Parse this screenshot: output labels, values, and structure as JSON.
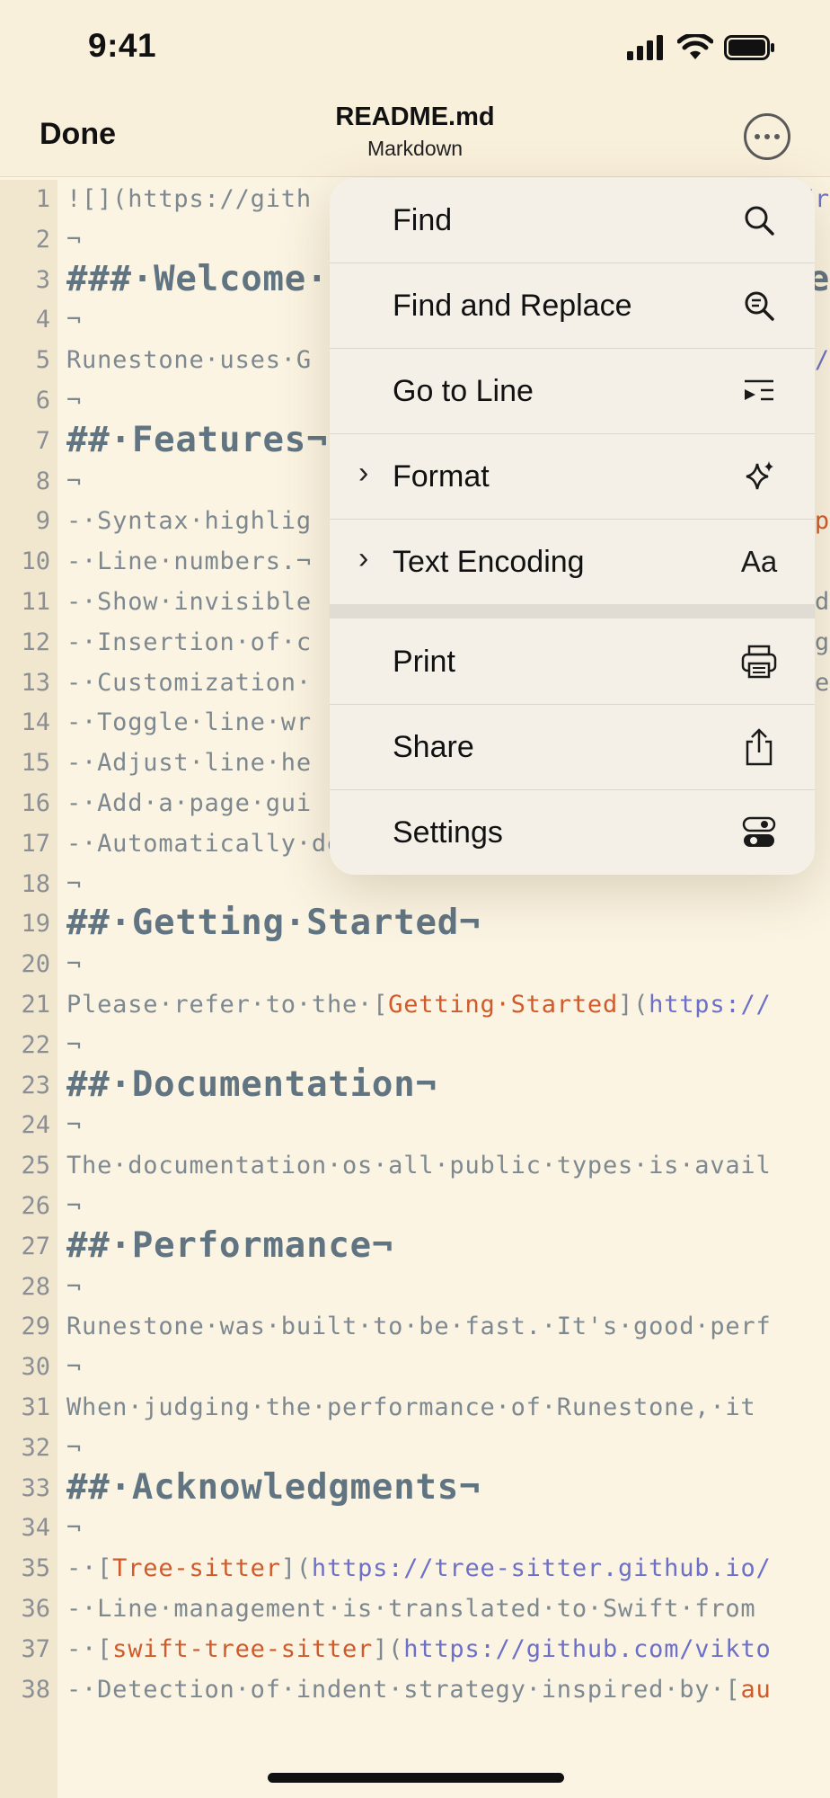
{
  "status": {
    "time": "9:41"
  },
  "nav": {
    "done": "Done",
    "title": "README.md",
    "subtitle": "Markdown"
  },
  "editor": {
    "lines": [
      {
        "n": "1",
        "t": "![](https://gith",
        "end": "/r"
      },
      {
        "n": "2",
        "t": "¬"
      },
      {
        "n": "3",
        "t": "###·Welcome·t",
        "end": "e",
        "h": true
      },
      {
        "n": "4",
        "t": "¬"
      },
      {
        "n": "5",
        "t": "Runestone·uses·G",
        "end": "//"
      },
      {
        "n": "6",
        "t": "¬"
      },
      {
        "n": "7",
        "t": "##·Features¬",
        "h": true
      },
      {
        "n": "8",
        "t": "¬"
      },
      {
        "n": "9",
        "t": "-·Syntax·highlig",
        "end": "ap"
      },
      {
        "n": "10",
        "t": "-·Line·numbers.¬"
      },
      {
        "n": "11",
        "t": "-·Show·invisible",
        "end": "d"
      },
      {
        "n": "12",
        "t": "-·Insertion·of·c",
        "end": "ng"
      },
      {
        "n": "13",
        "t": "-·Customization·",
        "end": "e"
      },
      {
        "n": "14",
        "t": "-·Toggle·line·wr"
      },
      {
        "n": "15",
        "t": "-·Adjust·line·he"
      },
      {
        "n": "16",
        "t": "-·Add·a·page·gui"
      },
      {
        "n": "17",
        "t": "-·Automatically·detects·if·a·file·is·using·spa"
      },
      {
        "n": "18",
        "t": "¬"
      },
      {
        "n": "19",
        "t": "##·Getting·Started¬",
        "h": true
      },
      {
        "n": "20",
        "t": "¬"
      },
      {
        "n": "21",
        "t": "Please·refer·to·the·[",
        "lt": "Getting·Started",
        "t2": "](",
        "url": "https://"
      },
      {
        "n": "22",
        "t": "¬"
      },
      {
        "n": "23",
        "t": "##·Documentation¬",
        "h": true
      },
      {
        "n": "24",
        "t": "¬"
      },
      {
        "n": "25",
        "t": "The·documentation·os·all·public·types·is·avail"
      },
      {
        "n": "26",
        "t": "¬"
      },
      {
        "n": "27",
        "t": "##·Performance¬",
        "h": true
      },
      {
        "n": "28",
        "t": "¬"
      },
      {
        "n": "29",
        "t": "Runestone·was·built·to·be·fast.·It's·good·perf"
      },
      {
        "n": "30",
        "t": "¬"
      },
      {
        "n": "31",
        "t": "When·judging·the·performance·of·Runestone,·it"
      },
      {
        "n": "32",
        "t": "¬"
      },
      {
        "n": "33",
        "t": "##·Acknowledgments¬",
        "h": true
      },
      {
        "n": "34",
        "t": "¬"
      },
      {
        "n": "35",
        "t": "-·[",
        "lt": "Tree-sitter",
        "t2": "](",
        "url": "https://tree-sitter.github.io/"
      },
      {
        "n": "36",
        "t": "-·Line·management·is·translated·to·Swift·from"
      },
      {
        "n": "37",
        "t": "-·[",
        "lt": "swift-tree-sitter",
        "t2": "](",
        "url": "https://github.com/vikto"
      },
      {
        "n": "38",
        "t": "-·Detection·of·indent·strategy·inspired·by·[",
        "lt": "au"
      }
    ]
  },
  "menu": {
    "items": [
      {
        "label": "Find",
        "icon": "search-icon"
      },
      {
        "label": "Find and Replace",
        "icon": "find-replace-icon"
      },
      {
        "label": "Go to Line",
        "icon": "go-to-line-icon"
      },
      {
        "label": "Format",
        "icon": "sparkles-icon",
        "submenu": true
      },
      {
        "label": "Text Encoding",
        "icon": "text-encoding-icon",
        "icon_text": "Aa",
        "submenu": true
      },
      {
        "label": "Print",
        "icon": "printer-icon"
      },
      {
        "label": "Share",
        "icon": "share-icon"
      },
      {
        "label": "Settings",
        "icon": "toggles-icon"
      }
    ],
    "submenu_chevron": "›"
  }
}
